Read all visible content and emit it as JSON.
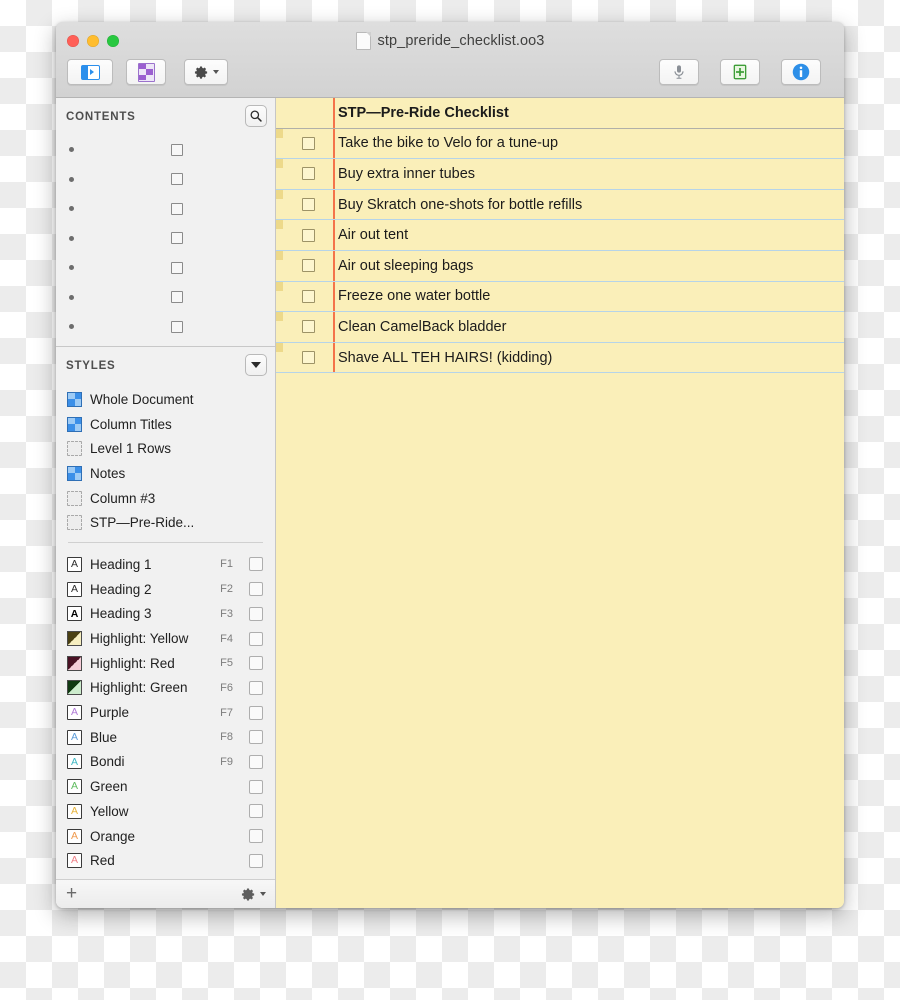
{
  "window": {
    "title": "stp_preride_checklist.oo3",
    "doc_icon": "document-icon",
    "traffic_lights": [
      "close-red",
      "minimize-yellow",
      "zoom-green"
    ]
  },
  "toolbar": {
    "left_buttons": [
      {
        "name": "sidebar-toggle-button",
        "icon": "sidebar-toggle-icon",
        "label": ""
      },
      {
        "name": "style-attributes-button",
        "icon": "purple-document-icon",
        "label": ""
      },
      {
        "name": "settings-action-button",
        "icon": "gear-icon",
        "label": ""
      }
    ],
    "right_buttons": [
      {
        "name": "dictation-button",
        "icon": "microphone-icon",
        "label": ""
      },
      {
        "name": "add-document-button",
        "icon": "green-add-document-icon",
        "label": ""
      },
      {
        "name": "inspector-button",
        "icon": "info-icon",
        "label": ""
      }
    ]
  },
  "sidebar": {
    "contents": {
      "title": "CONTENTS",
      "search_icon": "search-icon",
      "rows": [
        {
          "bullet": "•",
          "checkbox": false
        },
        {
          "bullet": "•",
          "checkbox": false
        },
        {
          "bullet": "•",
          "checkbox": false
        },
        {
          "bullet": "•",
          "checkbox": false
        },
        {
          "bullet": "•",
          "checkbox": false
        },
        {
          "bullet": "•",
          "checkbox": false
        },
        {
          "bullet": "•",
          "checkbox": false
        }
      ]
    },
    "styles": {
      "title": "STYLES",
      "disclosure_icon": "chevron-down-icon",
      "document_styles": [
        {
          "label": "Whole Document",
          "icon": "checkerboard-blue-icon"
        },
        {
          "label": "Column Titles",
          "icon": "checkerboard-blue-icon"
        },
        {
          "label": "Level 1 Rows",
          "icon": "dashed-empty-icon"
        },
        {
          "label": "Notes",
          "icon": "checkerboard-blue-icon"
        },
        {
          "label": "Column #3",
          "icon": "dashed-empty-icon"
        },
        {
          "label": "STP—Pre-Ride...",
          "icon": "dashed-empty-icon"
        }
      ],
      "named_styles": [
        {
          "label": "Heading 1",
          "icon": "letter-a-icon",
          "shortcut": "F1",
          "letter": "A",
          "letter_color": "#2b2b2b",
          "bold": false
        },
        {
          "label": "Heading 2",
          "icon": "letter-a-icon",
          "shortcut": "F2",
          "letter": "A",
          "letter_color": "#2b2b2b",
          "bold": false
        },
        {
          "label": "Heading 3",
          "icon": "letter-a-icon",
          "shortcut": "F3",
          "letter": "A",
          "letter_color": "#000000",
          "bold": true
        },
        {
          "label": "Highlight: Yellow",
          "icon": "highlight-swatch-icon",
          "shortcut": "F4",
          "dark": "#4a4012",
          "light": "#f6eec0"
        },
        {
          "label": "Highlight: Red",
          "icon": "highlight-swatch-icon",
          "shortcut": "F5",
          "dark": "#4a1224",
          "light": "#f6cdd8"
        },
        {
          "label": "Highlight: Green",
          "icon": "highlight-swatch-icon",
          "shortcut": "F6",
          "dark": "#113a12",
          "light": "#cdeccd"
        },
        {
          "label": "Purple",
          "icon": "letter-a-icon",
          "shortcut": "F7",
          "letter": "A",
          "letter_color": "#b07ad6",
          "bold": false
        },
        {
          "label": "Blue",
          "icon": "letter-a-icon",
          "shortcut": "F8",
          "letter": "A",
          "letter_color": "#5b9bd8",
          "bold": false
        },
        {
          "label": "Bondi",
          "icon": "letter-a-icon",
          "shortcut": "F9",
          "letter": "A",
          "letter_color": "#3fb8c4",
          "bold": false
        },
        {
          "label": "Green",
          "icon": "letter-a-icon",
          "shortcut": "",
          "letter": "A",
          "letter_color": "#5fbb5f",
          "bold": false
        },
        {
          "label": "Yellow",
          "icon": "letter-a-icon",
          "shortcut": "",
          "letter": "A",
          "letter_color": "#e8b43a",
          "bold": false
        },
        {
          "label": "Orange",
          "icon": "letter-a-icon",
          "shortcut": "",
          "letter": "A",
          "letter_color": "#ef9a4e",
          "bold": false
        },
        {
          "label": "Red",
          "icon": "letter-a-icon",
          "shortcut": "",
          "letter": "A",
          "letter_color": "#ee7e86",
          "bold": false
        }
      ]
    },
    "footer": {
      "add_label": "+",
      "add_icon": "plus-icon",
      "gear_icon": "gear-icon",
      "chevron_icon": "chevron-down-icon"
    }
  },
  "outline": {
    "header_row": {
      "text": "STP—Pre-Ride Checklist",
      "checkbox": false
    },
    "rows": [
      {
        "text": "Take the bike to Velo for a tune-up",
        "checked": false
      },
      {
        "text": "Buy extra inner tubes",
        "checked": false
      },
      {
        "text": "Buy Skratch one-shots for bottle refills",
        "checked": false
      },
      {
        "text": "Air out tent",
        "checked": false
      },
      {
        "text": "Air out sleeping bags",
        "checked": false
      },
      {
        "text": "Freeze one water bottle",
        "checked": false
      },
      {
        "text": "Clean CamelBack bladder",
        "checked": false
      },
      {
        "text": "Shave ALL TEH HAIRS! (kidding)",
        "checked": false
      }
    ]
  },
  "colors": {
    "page_background": "#faefb9",
    "row_separator": "#b6d4e8",
    "column_divider": "#f4734a",
    "sidebar_background": "#f1f1f1",
    "titlebar": "#d6d6d6"
  }
}
